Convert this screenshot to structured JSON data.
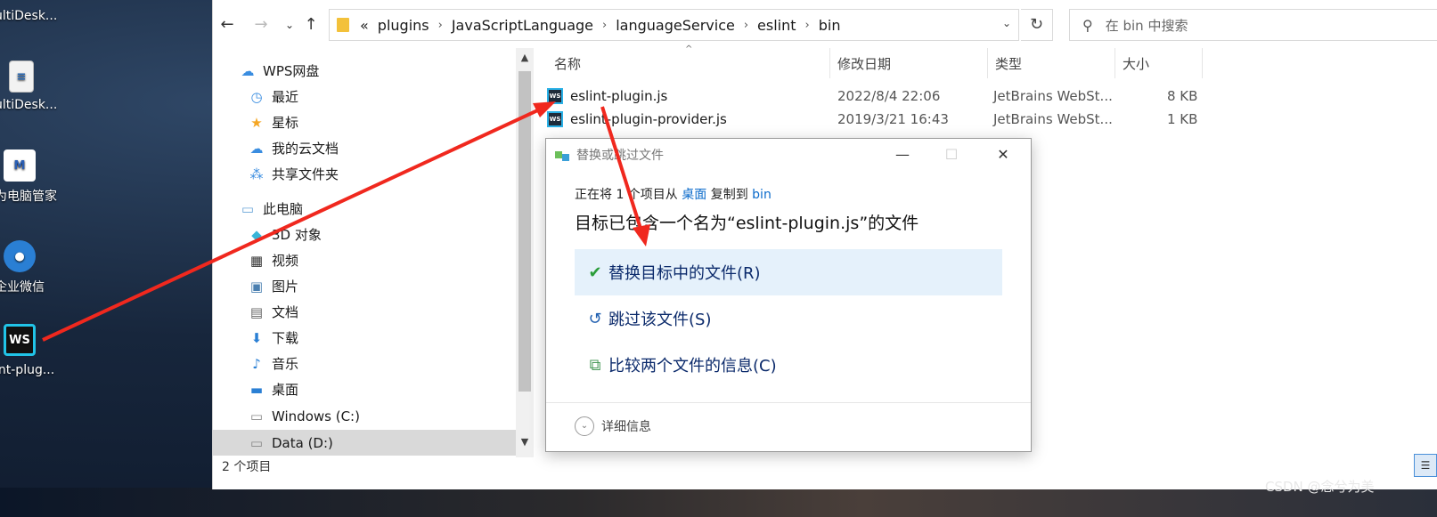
{
  "desktop": {
    "icons": [
      {
        "label": "ultiDesk...",
        "icon": "doc-icon"
      },
      {
        "label": "ultiDesk...",
        "icon": "doc-icon"
      },
      {
        "label": "为电脑管家",
        "icon": "huawei-icon"
      },
      {
        "label": "企业微信",
        "icon": "wecom-icon"
      },
      {
        "label": "int-plug...",
        "icon": "webstorm-icon"
      }
    ],
    "watermark": "CSDN @念兮为美"
  },
  "explorer": {
    "breadcrumb": [
      "«",
      "plugins",
      "JavaScriptLanguage",
      "languageService",
      "eslint",
      "bin"
    ],
    "search_placeholder": "在 bin 中搜索",
    "nav": [
      {
        "label": "WPS网盘",
        "icon": "cloud-icon",
        "color": "#3a8de0"
      },
      {
        "label": "最近",
        "icon": "clock-icon",
        "color": "#3a8de0"
      },
      {
        "label": "星标",
        "icon": "star-icon",
        "color": "#f5a623"
      },
      {
        "label": "我的云文档",
        "icon": "cloud-doc-icon",
        "color": "#3a8de0"
      },
      {
        "label": "共享文件夹",
        "icon": "share-folder-icon",
        "color": "#3a8de0"
      },
      {
        "label": "此电脑",
        "icon": "computer-icon",
        "color": "#6aa6d8"
      },
      {
        "label": "3D 对象",
        "icon": "cube-icon",
        "color": "#38b5d8"
      },
      {
        "label": "视频",
        "icon": "film-icon",
        "color": "#333333"
      },
      {
        "label": "图片",
        "icon": "picture-icon",
        "color": "#4a7fb0"
      },
      {
        "label": "文档",
        "icon": "document-icon",
        "color": "#666666"
      },
      {
        "label": "下载",
        "icon": "download-icon",
        "color": "#2a7fd4"
      },
      {
        "label": "音乐",
        "icon": "music-icon",
        "color": "#2a7fd4"
      },
      {
        "label": "桌面",
        "icon": "desktop-icon",
        "color": "#2a7fd4"
      },
      {
        "label": "Windows (C:)",
        "icon": "drive-icon",
        "color": "#888888"
      },
      {
        "label": "Data (D:)",
        "icon": "drive-icon",
        "color": "#888888"
      }
    ],
    "columns": [
      "名称",
      "修改日期",
      "类型",
      "大小"
    ],
    "files": [
      {
        "name": "eslint-plugin.js",
        "date": "2022/8/4 22:06",
        "type": "JetBrains WebSt...",
        "size": "8 KB"
      },
      {
        "name": "eslint-plugin-provider.js",
        "date": "2019/3/21 16:43",
        "type": "JetBrains WebSt...",
        "size": "1 KB"
      }
    ],
    "status": "2 个项目"
  },
  "dialog": {
    "title": "替换或跳过文件",
    "line1_pre": "正在将 1 个项目从 ",
    "line1_src": "桌面",
    "line1_mid": " 复制到 ",
    "line1_dst": "bin",
    "line2": "目标已包含一个名为“eslint-plugin.js”的文件",
    "options": [
      {
        "label": "替换目标中的文件(R)",
        "icon": "check-icon"
      },
      {
        "label": "跳过该文件(S)",
        "icon": "skip-icon"
      },
      {
        "label": "比较两个文件的信息(C)",
        "icon": "compare-icon"
      }
    ],
    "details": "详细信息"
  },
  "colors": {
    "arrow": "#f0281e",
    "link": "#0b6bcb",
    "highlight": "#e5f1fb"
  }
}
